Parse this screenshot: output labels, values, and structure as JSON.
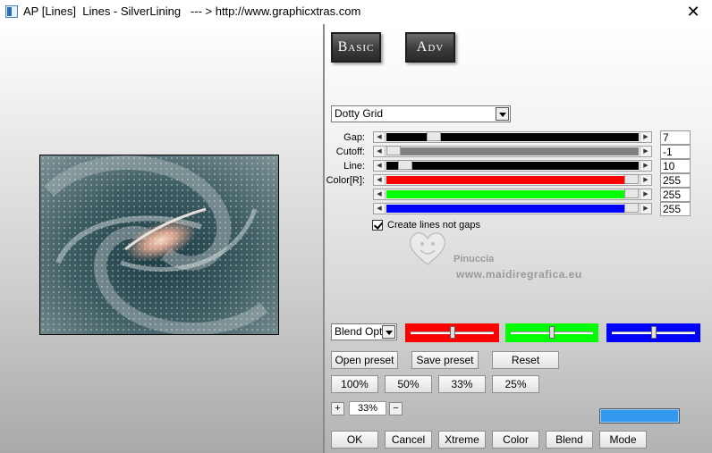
{
  "window": {
    "title": "AP [Lines]  Lines - SilverLining   --- > http://www.graphicxtras.com",
    "close_label": "✕"
  },
  "modes": {
    "basic_label": "Basic",
    "adv_label": "Adv"
  },
  "preset_dropdown": {
    "value": "Dotty Grid"
  },
  "sliders": [
    {
      "label": "Gap:",
      "value": "7",
      "fill": 0.17,
      "track": "black"
    },
    {
      "label": "Cutoff:",
      "value": "-1",
      "fill": 0.0,
      "track": "gray"
    },
    {
      "label": "Line:",
      "value": "10",
      "fill": 0.05,
      "track": "black"
    },
    {
      "label": "Color[R]:",
      "value": "255",
      "fill": 1.0,
      "track": "red"
    },
    {
      "label": "",
      "value": "255",
      "fill": 1.0,
      "track": "green"
    },
    {
      "label": "",
      "value": "255",
      "fill": 1.0,
      "track": "blue"
    }
  ],
  "checkbox": {
    "label": "Create lines not gaps",
    "checked": true
  },
  "watermark": {
    "line1": "Pinuccia",
    "line2": "www.maidiregrafica.eu"
  },
  "blend_dropdown": {
    "value": "Blend Optio"
  },
  "color_sliders": [
    {
      "color": "#ff0000",
      "level": 0.5
    },
    {
      "color": "#00ff00",
      "level": 0.5
    },
    {
      "color": "#0000ff",
      "level": 0.5
    }
  ],
  "preset_buttons": {
    "open": "Open preset",
    "save": "Save preset",
    "reset": "Reset"
  },
  "zoom_buttons": [
    "100%",
    "50%",
    "33%",
    "25%"
  ],
  "zoom": {
    "plus": "+",
    "value": "33%",
    "minus": "−"
  },
  "swatch_color": "#3399ee",
  "bottom_buttons": [
    "OK",
    "Cancel",
    "Xtreme",
    "Color",
    "Blend",
    "Mode"
  ]
}
